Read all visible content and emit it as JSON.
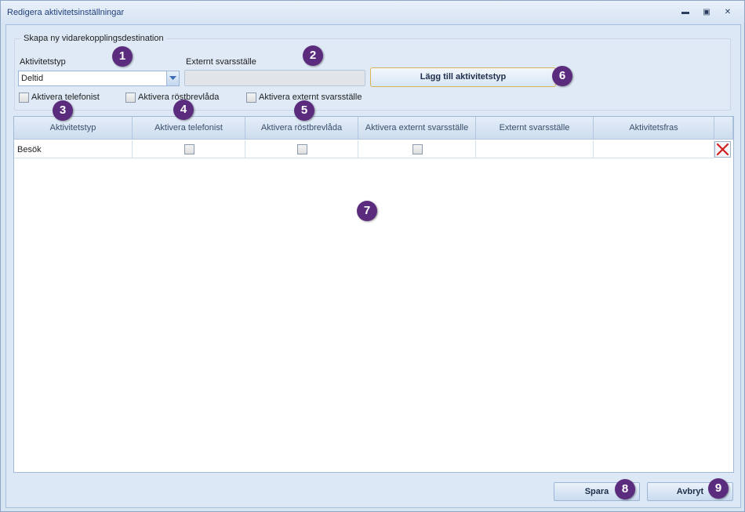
{
  "window": {
    "title": "Redigera aktivitetsinställningar",
    "minimize_glyph": "▬",
    "maximize_glyph": "▣",
    "close_glyph": "✕"
  },
  "group": {
    "legend": "Skapa ny vidarekopplingsdestination",
    "activity_type_label": "Aktivitetstyp",
    "activity_type_value": "Deltid",
    "external_label": "Externt svarsställe",
    "external_value": "",
    "add_button": "Lägg till aktivitetstyp",
    "checkboxes": [
      {
        "label": "Aktivera telefonist",
        "checked": false
      },
      {
        "label": "Aktivera röstbrevlåda",
        "checked": false
      },
      {
        "label": "Aktivera externt svarsställe",
        "checked": false
      }
    ]
  },
  "table": {
    "headers": [
      "Aktivitetstyp",
      "Aktivera telefonist",
      "Aktivera röstbrevlåda",
      "Aktivera externt svarsställe",
      "Externt svarsställe",
      "Aktivitetsfras",
      ""
    ],
    "rows": [
      {
        "activity_type": "Besök",
        "telefonist": false,
        "rostbrevlada": false,
        "externt": false,
        "external_point": "",
        "phrase": ""
      }
    ]
  },
  "footer": {
    "save": "Spara",
    "cancel": "Avbryt"
  },
  "badges": [
    "1",
    "2",
    "3",
    "4",
    "5",
    "6",
    "7",
    "8",
    "9"
  ],
  "colors": {
    "badge": "#5b2c7d",
    "accent_border": "#d9b455",
    "delete_icon": "#d21f1f"
  }
}
